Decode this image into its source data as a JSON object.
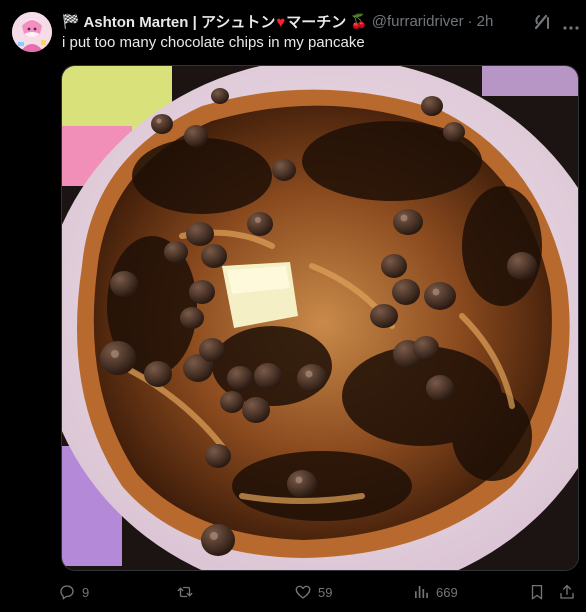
{
  "post": {
    "author": {
      "flag_emoji": "🏁",
      "name_part1": "Ashton Marten | アシュトン",
      "heart_emoji": "♥",
      "name_part2": "マーチン",
      "cherry_emoji": "🍒",
      "handle": "@furraridriver",
      "separator": "·",
      "time": "2h"
    },
    "text": "i put too many chocolate chips in my pancake"
  },
  "actions": {
    "replies": "9",
    "reposts": "",
    "likes": "59",
    "views": "669"
  },
  "icons": {
    "reply": "reply-icon",
    "repost": "repost-icon",
    "like": "heart-icon",
    "views": "views-icon",
    "bookmark": "bookmark-icon",
    "share": "share-icon",
    "grok": "grok-icon",
    "more": "more-icon"
  },
  "colors": {
    "background": "#000000",
    "text_primary": "#e7e9ea",
    "text_secondary": "#71767b"
  }
}
